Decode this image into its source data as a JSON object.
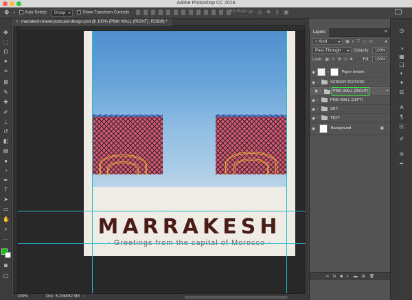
{
  "window": {
    "title": "Adobe Photoshop CC 2018",
    "traffic_colors": [
      "#fc5f57",
      "#fdbc2e",
      "#28c840"
    ]
  },
  "options": {
    "auto_select_label": "Auto-Select:",
    "auto_select_value": "Group",
    "transform_label": "Show Transform Controls",
    "mode_3d": "3D Mode:"
  },
  "document": {
    "tab_label": "marrakesh-travel-postcard-design.psd @ 100% (PINK WALL (RIGHT), RGB/8) *",
    "heading": "MARRAKESH",
    "subheading": "- Greetings from the capital of Morocco -"
  },
  "status": {
    "zoom": "100%",
    "doc": "Doc: 6.20M/82.9M"
  },
  "layers_panel": {
    "title": "Layers",
    "kind_filter": "Kind",
    "blend_mode": "Pass Through",
    "opacity_label": "Opacity:",
    "opacity_value": "100%",
    "lock_label": "Lock:",
    "fill_label": "Fill:",
    "fill_value": "100%",
    "layers": [
      {
        "name": "Paper texture",
        "type": "adjustment"
      },
      {
        "name": "SCREEN TEXTURE",
        "type": "group"
      },
      {
        "name": "PINK WALL (RIGHT)",
        "type": "group",
        "selected": true
      },
      {
        "name": "PINK WALL (LEFT)",
        "type": "group"
      },
      {
        "name": "SKY",
        "type": "group"
      },
      {
        "name": "TEXT",
        "type": "group"
      },
      {
        "name": "Background",
        "type": "background"
      }
    ]
  },
  "colors": {
    "accent_selected": "#3fe04a",
    "heading": "#4a1c17",
    "guide": "#27b9c9",
    "foreground_swatch": "#00c800"
  },
  "icons": {
    "move_tool": "move-icon",
    "eye": "eye-icon",
    "folder": "folder-icon",
    "lock": "lock-icon"
  }
}
